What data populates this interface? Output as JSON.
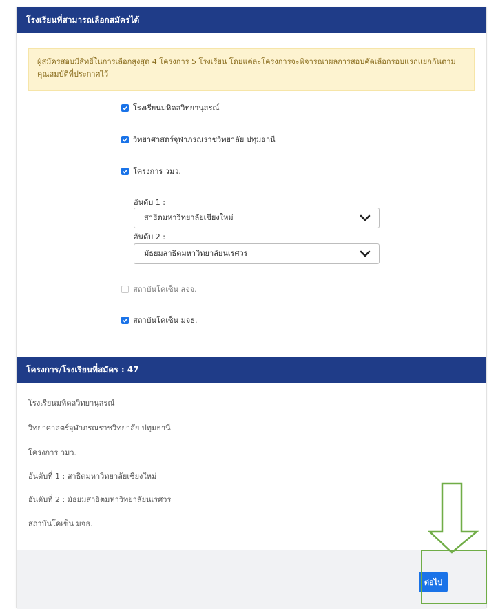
{
  "section_title": "โรงเรียนที่สามารถเลือกสมัครได้",
  "notice": "ผู้สมัครสอบมีสิทธิ์ในการเลือกสูงสุด 4 โครงการ 5 โรงเรียน โดยแต่ละโครงการจะพิจารณาผลการสอบคัดเลือกรอบแรกแยกกันตามคุณสมบัติที่ประกาศไว้",
  "options": [
    {
      "label": "โรงเรียนมหิดลวิทยานุสรณ์",
      "checked": true
    },
    {
      "label": "วิทยาศาสตร์จุฬาภรณราชวิทยาลัย ปทุมธานี",
      "checked": true
    },
    {
      "label": "โครงการ วมว.",
      "checked": true
    },
    {
      "label": "สถาบันโคเซ็น สจจ.",
      "checked": false
    },
    {
      "label": "สถาบันโคเซ็น มจธ.",
      "checked": true
    }
  ],
  "ranks": [
    {
      "label": "อันดับ 1 :",
      "value": "สาธิตมหาวิทยาลัยเชียงใหม่"
    },
    {
      "label": "อันดับ 2 :",
      "value": "มัธยมสาธิตมหาวิทยาลัยนเรศวร"
    }
  ],
  "summary": {
    "title": "โครงการ/โรงเรียนที่สมัคร : 47",
    "lines": [
      "โรงเรียนมหิดลวิทยานุสรณ์",
      "วิทยาศาสตร์จุฬาภรณราชวิทยาลัย ปทุมธานี",
      "โครงการ วมว.",
      "อันดับที่ 1 : สาธิตมหาวิทยาลัยเชียงใหม่",
      "อันดับที่ 2 : มัธยมสาธิตมหาวิทยาลัยนเรศวร",
      "สถาบันโคเซ็น มจธ."
    ]
  },
  "next_button": "ต่อไป",
  "colors": {
    "header": "#1f3c88",
    "accent": "#1a73e8",
    "notice_bg": "#fdf3d0",
    "highlight": "#70ad47"
  }
}
